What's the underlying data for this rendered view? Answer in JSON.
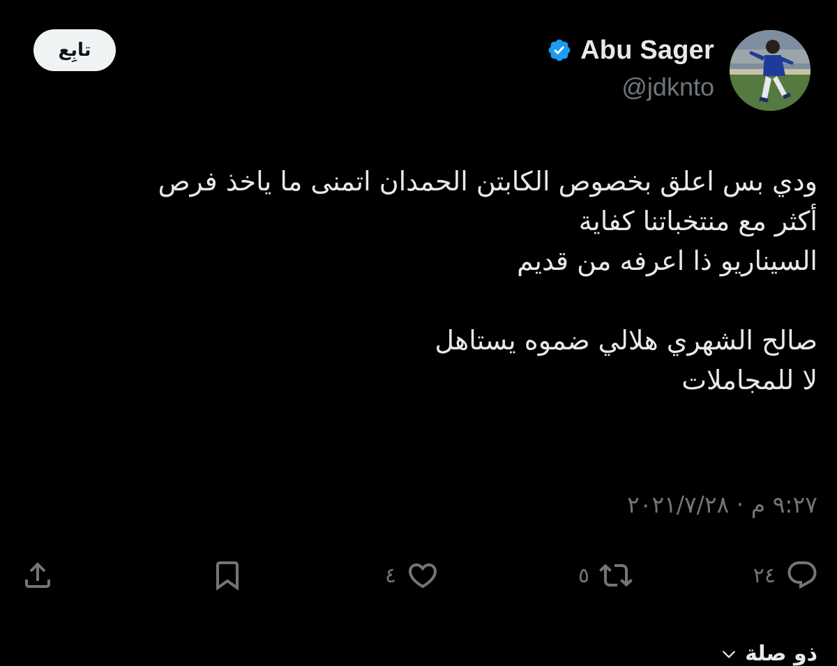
{
  "author": {
    "display_name": "Abu Sager",
    "handle": "@jdknto",
    "verified": true,
    "verified_color": "#1d9bf0"
  },
  "follow_button": {
    "label": "تابِع"
  },
  "tweet": {
    "lines": [
      "ودي بس اعلق بخصوص الكابتن الحمدان اتمنى ما ياخذ فرص",
      "أكثر مع منتخباتنا كفاية",
      "السيناريو ذا اعرفه من قديم",
      "",
      "صالح الشهري هلالي ضموه يستاهل",
      "لا للمجاملات"
    ],
    "timestamp": "٩:٢٧ م · ٢٠٢١/٧/٢٨"
  },
  "actions": {
    "reply_count": "٢٤",
    "retweet_count": "٥",
    "like_count": "٤",
    "reply_icon": "reply-icon",
    "retweet_icon": "retweet-icon",
    "like_icon": "heart-icon",
    "bookmark_icon": "bookmark-icon",
    "share_icon": "share-icon"
  },
  "related": {
    "label": "ذو صلة"
  },
  "colors": {
    "background": "#000000",
    "text_primary": "#e7e9ea",
    "text_secondary": "#71767b",
    "follow_bg": "#eff3f4"
  }
}
